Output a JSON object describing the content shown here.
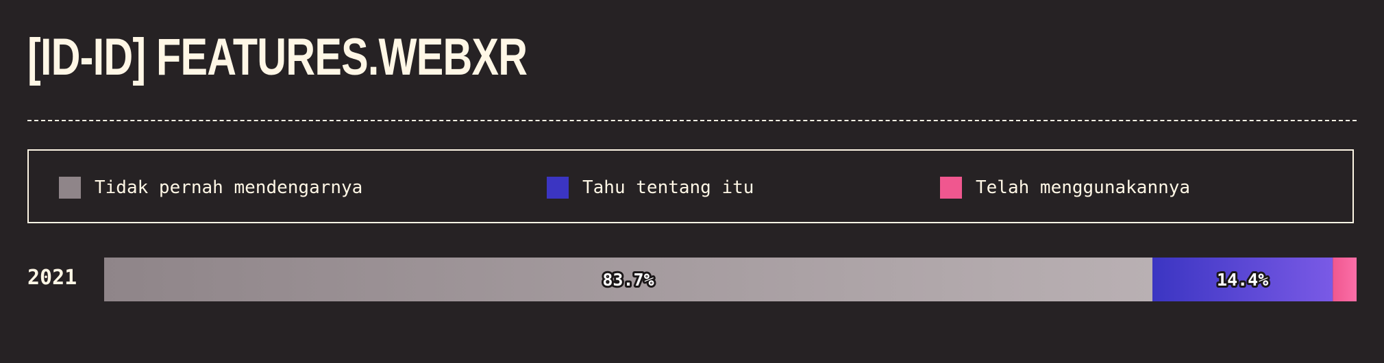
{
  "header": {
    "title": "[ID-ID] FEATURES.WEBXR"
  },
  "legend": {
    "items": [
      {
        "label": "Tidak pernah mendengarnya",
        "color": "#8f8589"
      },
      {
        "label": "Tahu tentang itu",
        "color": "#3b35c2"
      },
      {
        "label": "Telah menggunakannya",
        "color": "#f0578f"
      }
    ]
  },
  "chart_data": {
    "type": "bar",
    "orientation": "horizontal-stacked",
    "categories": [
      "2021"
    ],
    "series": [
      {
        "name": "Tidak pernah mendengarnya",
        "values": [
          83.7
        ],
        "label": "83.7%",
        "color_start": "#8f8589",
        "color_end": "#b9b0b3"
      },
      {
        "name": "Tahu tentang itu",
        "values": [
          14.4
        ],
        "label": "14.4%",
        "color_start": "#3b35c2",
        "color_end": "#7a5ae6"
      },
      {
        "name": "Telah menggunakannya",
        "values": [
          1.9
        ],
        "label": "",
        "color_start": "#f0578f",
        "color_end": "#fb6fa8"
      }
    ],
    "xlim": [
      0,
      100
    ]
  }
}
